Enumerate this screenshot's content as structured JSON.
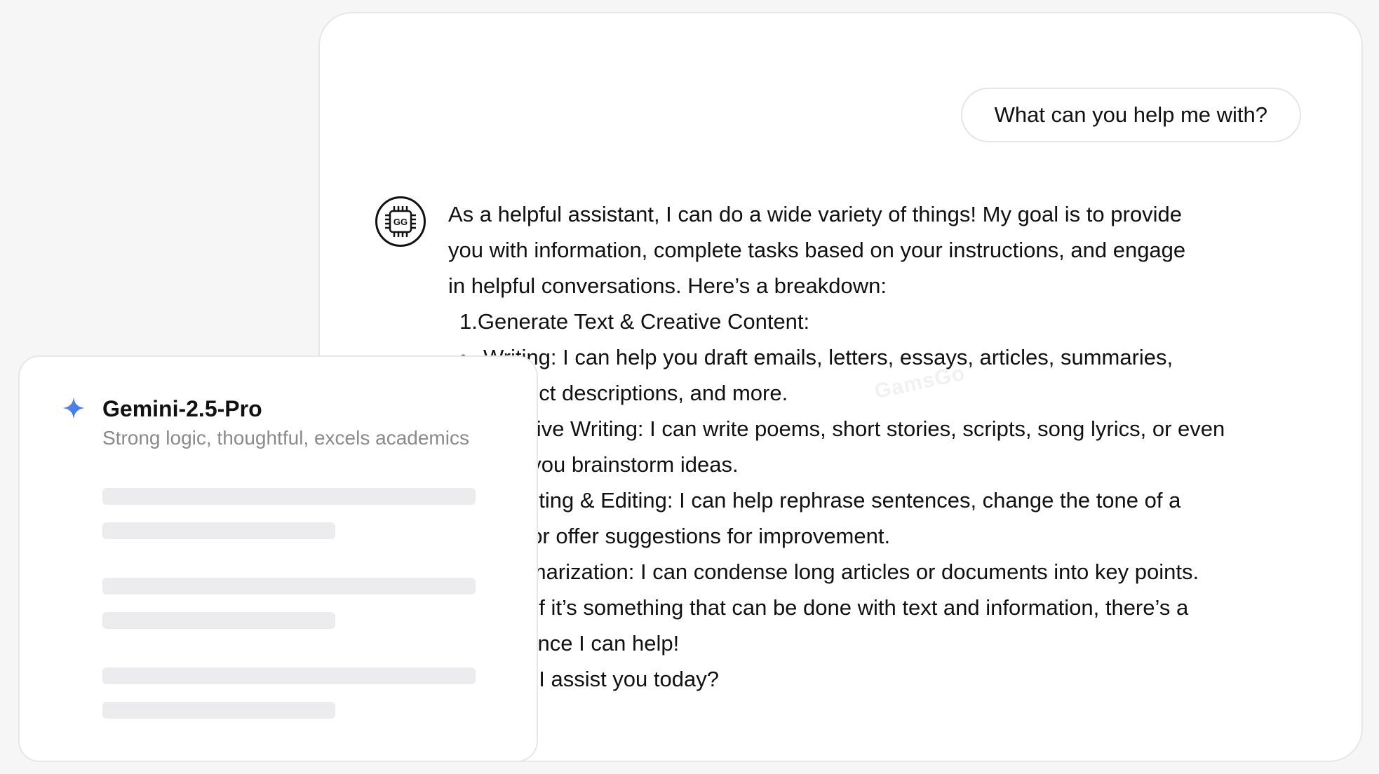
{
  "chat": {
    "user_message": "What can you help me with?",
    "avatar_label": "GG",
    "watermark": "GamsGo",
    "answer_lines": [
      "As a helpful assistant, I can do a wide variety of things! My goal is to provide",
      "you with information, complete tasks based on your instructions, and engage",
      "in helpful conversations. Here’s a breakdown:",
      "1.Generate Text & Creative Content:",
      "Writing: I can help you draft emails, letters, essays, articles, summaries,",
      "product descriptions, and more.",
      "Creative Writing: I can write poems, short stories, scripts, song lyrics, or even",
      "help you brainstorm ideas.",
      "Rewriting & Editing: I can help rephrase sentences, change the tone of a",
      "text, or offer suggestions for improvement.",
      "Summarization: I can condense long articles or documents into key points.",
      "In short: If it’s something that can be done with text and information, there’s a",
      "good chance I can help!",
      "How can I assist you today?"
    ]
  },
  "model_card": {
    "name": "Gemini-2.5-Pro",
    "description": "Strong logic, thoughtful, excels academics",
    "sparkle_color": "#4a7ee8"
  }
}
